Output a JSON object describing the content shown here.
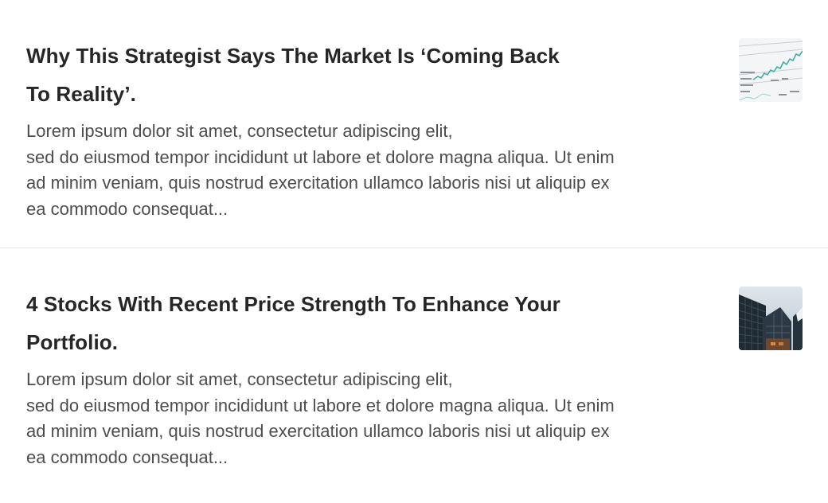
{
  "articles": [
    {
      "title_lines": [
        "Why This Strategist Says The Market Is ‘Coming Back",
        "To Reality’."
      ],
      "excerpt_lines": [
        "Lorem ipsum dolor sit amet, consectetur adipiscing elit,",
        "sed do eiusmod tempor incididunt ut labore et dolore magna aliqua. Ut enim",
        "ad minim veniam, quis nostrud exercitation ullamco laboris nisi ut aliquip ex",
        "ea commodo consequat..."
      ],
      "thumbnail_icon": "stock-chart-photo"
    },
    {
      "title_lines": [
        "4 Stocks With Recent Price Strength To Enhance Your",
        "Portfolio."
      ],
      "excerpt_lines": [
        "Lorem ipsum dolor sit amet, consectetur adipiscing elit,",
        "sed do eiusmod tempor incididunt ut labore et dolore magna aliqua. Ut enim",
        "ad minim veniam, quis nostrud exercitation ullamco laboris nisi ut aliquip ex",
        "ea commodo consequat..."
      ],
      "thumbnail_icon": "skyscraper-photo"
    }
  ],
  "colors": {
    "title": "#262626",
    "excerpt": "#4d4d4d",
    "divider": "#e6e6e6",
    "background": "#ffffff"
  }
}
